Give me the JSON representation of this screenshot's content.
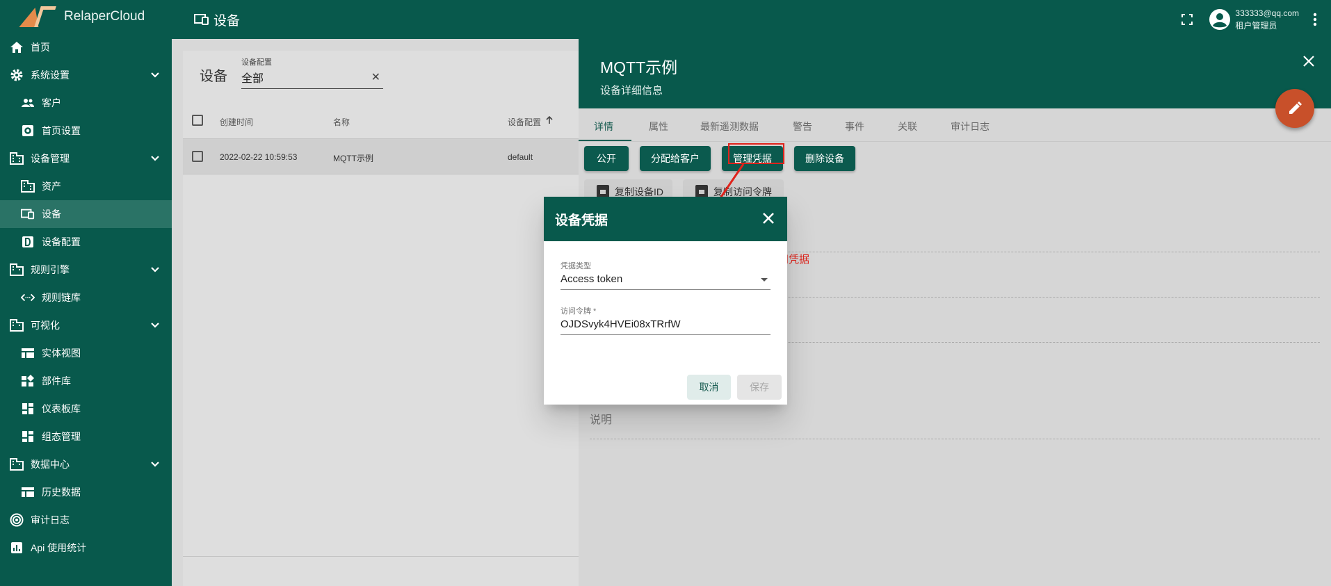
{
  "app": {
    "name": "RelaperCloud"
  },
  "sidebar": {
    "items": [
      {
        "label": "首页",
        "icon": "home-icon"
      },
      {
        "label": "系统设置",
        "icon": "gear-icon",
        "expandable": true
      },
      {
        "label": "客户",
        "icon": "people-icon",
        "sub": true
      },
      {
        "label": "首页设置",
        "icon": "settings-box-icon",
        "sub": true
      },
      {
        "label": "设备管理",
        "icon": "building-icon",
        "expandable": true
      },
      {
        "label": "资产",
        "icon": "building-icon",
        "sub": true
      },
      {
        "label": "设备",
        "icon": "device-icon",
        "sub": true,
        "active": true
      },
      {
        "label": "设备配置",
        "icon": "d-box-icon",
        "sub": true
      },
      {
        "label": "规则引擎",
        "icon": "building-icon",
        "expandable": true
      },
      {
        "label": "规则链库",
        "icon": "code-arrows-icon",
        "sub": true
      },
      {
        "label": "可视化",
        "icon": "building-icon",
        "expandable": true
      },
      {
        "label": "实体视图",
        "icon": "view-icon",
        "sub": true
      },
      {
        "label": "部件库",
        "icon": "widgets-icon",
        "sub": true
      },
      {
        "label": "仪表板库",
        "icon": "dashboard-icon",
        "sub": true
      },
      {
        "label": "组态管理",
        "icon": "dashboard-icon",
        "sub": true
      },
      {
        "label": "数据中心",
        "icon": "building-icon",
        "expandable": true
      },
      {
        "label": "历史数据",
        "icon": "view-icon",
        "sub": true
      },
      {
        "label": "审计日志",
        "icon": "track-icon"
      },
      {
        "label": "Api 使用统计",
        "icon": "bar-chart-icon"
      }
    ]
  },
  "topbar": {
    "title": "设备",
    "user_email": "333333@qq.com",
    "user_role": "租户管理员"
  },
  "devices": {
    "title": "设备",
    "filter_label": "设备配置",
    "filter_value": "全部",
    "columns": [
      "创建时间",
      "名称",
      "设备配置"
    ],
    "rows": [
      {
        "created": "2022-02-22 10:59:53",
        "name": "MQTT示例",
        "profile": "default"
      }
    ]
  },
  "detail": {
    "title": "MQTT示例",
    "subtitle": "设备详细信息",
    "tabs": [
      "详情",
      "属性",
      "最新遥测数据",
      "警告",
      "事件",
      "关联",
      "审计日志"
    ],
    "actions": [
      "公开",
      "分配给客户",
      "管理凭据",
      "删除设备"
    ],
    "copy_buttons": [
      "复制设备ID",
      "复制访问令牌"
    ],
    "description_label": "说明"
  },
  "annotation": {
    "text": "查看访问凭据",
    "color": "#e0231b"
  },
  "dialog": {
    "title": "设备凭据",
    "credential_type_label": "凭据类型",
    "credential_type_value": "Access token",
    "token_label": "访问令牌 *",
    "token_value": "OJDSvyk4HVEi08xTRrfW",
    "cancel_label": "取消",
    "save_label": "保存"
  },
  "colors": {
    "primary": "#08594c",
    "accent": "#c8502a",
    "highlight": "#e0231b"
  }
}
